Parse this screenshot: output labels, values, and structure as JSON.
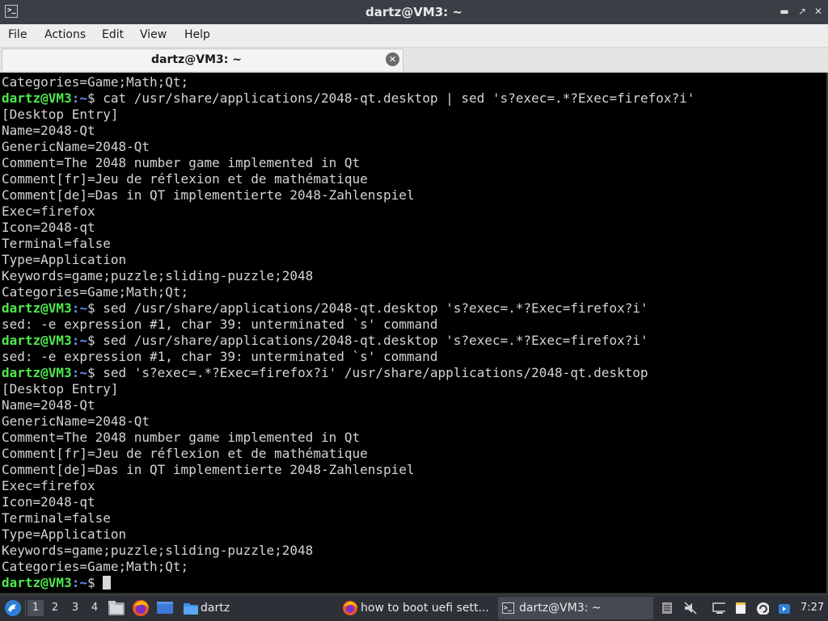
{
  "window": {
    "title": "dartz@VM3: ~"
  },
  "menu": [
    "File",
    "Actions",
    "Edit",
    "View",
    "Help"
  ],
  "tab": {
    "label": "dartz@VM3: ~"
  },
  "terminal": {
    "prompt_user": "dartz@VM3",
    "prompt_path": ":~",
    "prompt_symbol": "$",
    "lines": [
      {
        "text": "Categories=Game;Math;Qt;"
      },
      {
        "prompt": true,
        "cmd": " cat /usr/share/applications/2048-qt.desktop | sed 's?exec=.*?Exec=firefox?i'"
      },
      {
        "text": "[Desktop Entry]"
      },
      {
        "text": "Name=2048-Qt"
      },
      {
        "text": "GenericName=2048-Qt"
      },
      {
        "text": "Comment=The 2048 number game implemented in Qt"
      },
      {
        "text": "Comment[fr]=Jeu de réflexion et de mathématique"
      },
      {
        "text": "Comment[de]=Das in QT implementierte 2048-Zahlenspiel"
      },
      {
        "text": "Exec=firefox"
      },
      {
        "text": "Icon=2048-qt"
      },
      {
        "text": "Terminal=false"
      },
      {
        "text": "Type=Application"
      },
      {
        "text": "Keywords=game;puzzle;sliding-puzzle;2048"
      },
      {
        "text": "Categories=Game;Math;Qt;"
      },
      {
        "prompt": true,
        "cmd": " sed /usr/share/applications/2048-qt.desktop 's?exec=.*?Exec=firefox?i'"
      },
      {
        "text": "sed: -e expression #1, char 39: unterminated `s' command"
      },
      {
        "prompt": true,
        "cmd": " sed /usr/share/applications/2048-qt.desktop 's?exec=.*?Exec=firefox?i'"
      },
      {
        "text": "sed: -e expression #1, char 39: unterminated `s' command"
      },
      {
        "prompt": true,
        "cmd": " sed 's?exec=.*?Exec=firefox?i' /usr/share/applications/2048-qt.desktop"
      },
      {
        "text": "[Desktop Entry]"
      },
      {
        "text": "Name=2048-Qt"
      },
      {
        "text": "GenericName=2048-Qt"
      },
      {
        "text": "Comment=The 2048 number game implemented in Qt"
      },
      {
        "text": "Comment[fr]=Jeu de réflexion et de mathématique"
      },
      {
        "text": "Comment[de]=Das in QT implementierte 2048-Zahlenspiel"
      },
      {
        "text": "Exec=firefox"
      },
      {
        "text": "Icon=2048-qt"
      },
      {
        "text": "Terminal=false"
      },
      {
        "text": "Type=Application"
      },
      {
        "text": "Keywords=game;puzzle;sliding-puzzle;2048"
      },
      {
        "text": "Categories=Game;Math;Qt;"
      },
      {
        "prompt": true,
        "cmd": " ",
        "cursor": true
      }
    ]
  },
  "taskbar": {
    "workspaces": [
      "1",
      "2",
      "3",
      "4"
    ],
    "active_workspace": "1",
    "folder_task": "dartz",
    "tasks": [
      {
        "label": "how to boot uefi sett...",
        "icon": "firefox-icon"
      },
      {
        "label": "dartz@VM3: ~",
        "icon": "terminal-icon"
      }
    ],
    "clock": "7:27"
  },
  "colors": {
    "prompt_user": "#4fe84f",
    "prompt_path": "#6a8cf0",
    "terminal_bg": "#000000",
    "terminal_fg": "#d4d4d4"
  }
}
